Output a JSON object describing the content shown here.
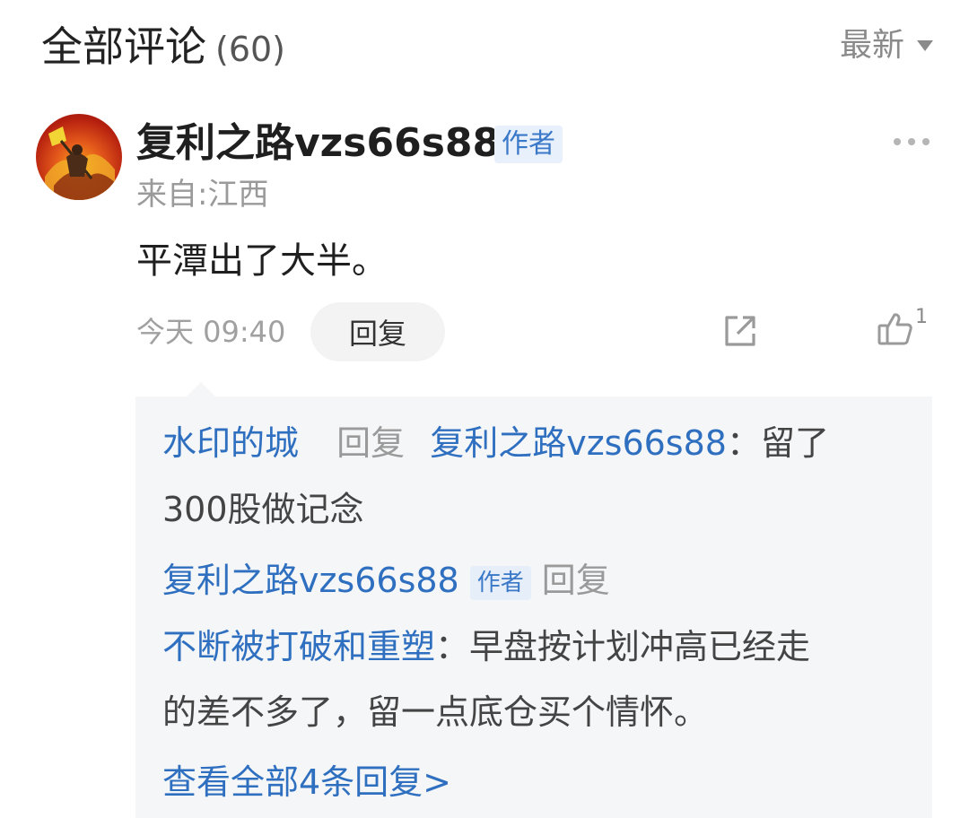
{
  "header": {
    "title": "全部评论",
    "count": "(60)",
    "sort_label": "最新"
  },
  "comment": {
    "author": "复利之路vzs66s88",
    "author_tag": "作者",
    "location": "来自:江西",
    "content": "平潭出了大半。",
    "time": "今天 09:40",
    "reply_label": "回复",
    "like_count": "1"
  },
  "replies": {
    "items": [
      {
        "user": "水印的城",
        "reply_word": "回复",
        "target": "复利之路vzs66s88",
        "colon": "：",
        "text_line1": "留了",
        "text_line2": "300股做记念"
      },
      {
        "user": "复利之路vzs66s88",
        "user_tag": "作者",
        "reply_word": "回复",
        "target": "不断被打破和重塑",
        "colon": "：",
        "text_line1": "早盘按计划冲高已经走",
        "text_line2": "的差不多了，留一点底仓买个情怀。"
      }
    ],
    "view_all": "查看全部4条回复>"
  },
  "colors": {
    "link_blue": "#2f6fc0",
    "tag_bg": "#e8f0fb",
    "reply_bg": "#f5f6f8"
  }
}
